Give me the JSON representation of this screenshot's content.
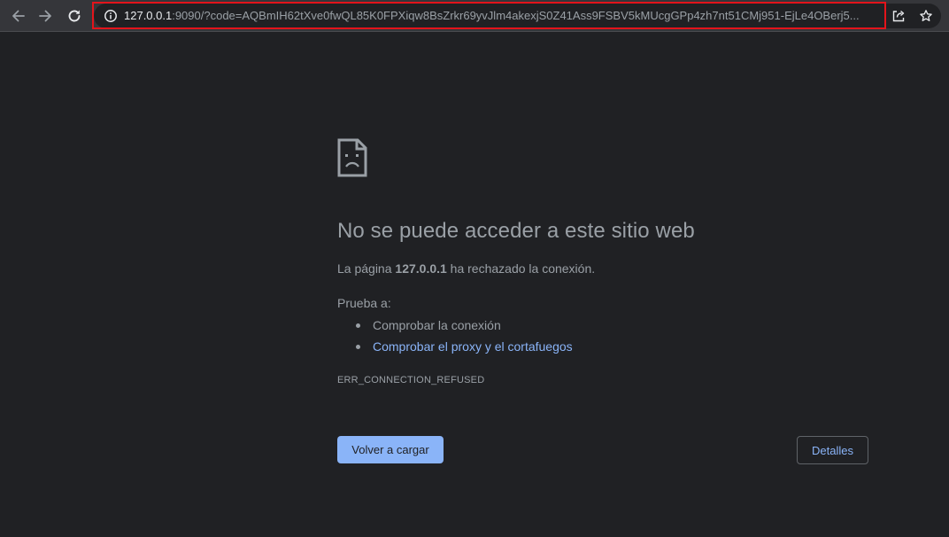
{
  "browser": {
    "url_host": "127.0.0.1",
    "url_rest": ":9090/?code=AQBmIH62tXve0fwQL85K0FPXiqw8BsZrkr69yvJlm4akexjS0Z41Ass9FSBV5kMUcgGPp4zh7nt51CMj951-EjLe4OBerj5...",
    "icons": {
      "back": "back-arrow-icon",
      "forward": "forward-arrow-icon",
      "reload": "reload-icon",
      "info": "info-icon",
      "share": "share-icon",
      "bookmark": "star-icon"
    },
    "highlight_color": "#e3141b"
  },
  "error_page": {
    "title": "No se puede acceder a este sitio web",
    "summary_prefix": "La página ",
    "summary_host": "127.0.0.1",
    "summary_suffix": " ha rechazado la conexión.",
    "try_label": "Prueba a:",
    "suggestions": [
      "Comprobar la conexión",
      "Comprobar el proxy y el cortafuegos"
    ],
    "error_code": "ERR_CONNECTION_REFUSED",
    "reload_button": "Volver a cargar",
    "details_button": "Detalles"
  },
  "colors": {
    "background": "#202124",
    "toolbar": "#35363a",
    "text": "#9aa0a6",
    "link": "#8ab4f8",
    "primary_button": "#8ab4f8"
  }
}
